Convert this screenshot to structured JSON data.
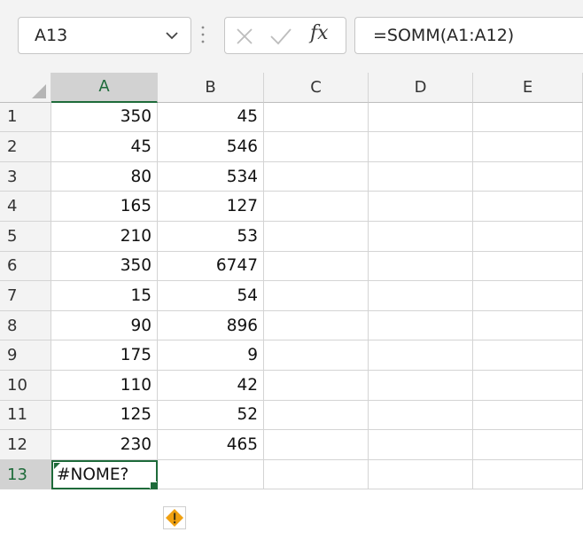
{
  "name_box": {
    "value": "A13"
  },
  "formula_bar": {
    "formula": "=SOMM(A1:A12)",
    "fx_label": "fx"
  },
  "icons": {
    "name_box_dropdown": "chevron-down-icon",
    "cancel": "close-icon",
    "enter": "check-icon",
    "error_option": "warning-icon"
  },
  "colors": {
    "selection_green": "#1e6b3a",
    "warning_orange": "#f0a010"
  },
  "columns": [
    "A",
    "B",
    "C",
    "D",
    "E"
  ],
  "rows": [
    {
      "num": "1",
      "a": "350",
      "b": "45"
    },
    {
      "num": "2",
      "a": "45",
      "b": "546"
    },
    {
      "num": "3",
      "a": "80",
      "b": "534"
    },
    {
      "num": "4",
      "a": "165",
      "b": "127"
    },
    {
      "num": "5",
      "a": "210",
      "b": "53"
    },
    {
      "num": "6",
      "a": "350",
      "b": "6747"
    },
    {
      "num": "7",
      "a": "15",
      "b": "54"
    },
    {
      "num": "8",
      "a": "90",
      "b": "896"
    },
    {
      "num": "9",
      "a": "175",
      "b": "9"
    },
    {
      "num": "10",
      "a": "110",
      "b": "42"
    },
    {
      "num": "11",
      "a": "125",
      "b": "52"
    },
    {
      "num": "12",
      "a": "230",
      "b": "465"
    },
    {
      "num": "13",
      "a": "#NOME?",
      "b": ""
    }
  ]
}
